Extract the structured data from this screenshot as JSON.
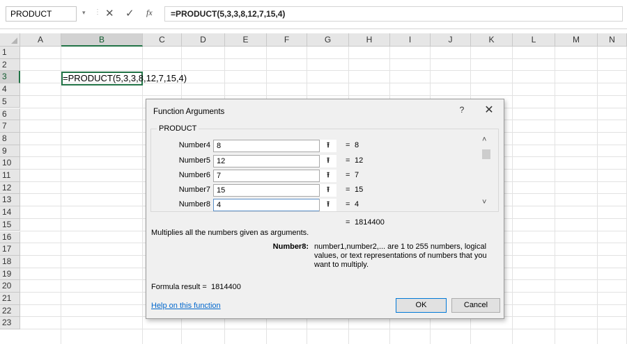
{
  "formula_bar": {
    "name_box": "PRODUCT",
    "name_box_arrow": "▾",
    "separator": "⋮",
    "cancel_glyph": "✕",
    "enter_glyph": "✓",
    "fx_label": "fx",
    "formula": "=PRODUCT(5,3,3,8,12,7,15,4)"
  },
  "grid": {
    "columns": [
      "A",
      "B",
      "C",
      "D",
      "E",
      "F",
      "G",
      "H",
      "I",
      "J",
      "K",
      "L",
      "M",
      "N"
    ],
    "rows": [
      "1",
      "2",
      "3",
      "4",
      "5",
      "6",
      "7",
      "8",
      "9",
      "10",
      "11",
      "12",
      "13",
      "14",
      "15",
      "16",
      "17",
      "18",
      "19",
      "20",
      "21",
      "22",
      "23"
    ],
    "active_column": "B",
    "active_row": "3",
    "cell_b3": "=PRODUCT(5,3,3,8,12,7,15,4)",
    "accent_color": "#217346"
  },
  "dialog": {
    "title": "Function Arguments",
    "help_glyph": "?",
    "close_glyph": "✕",
    "function_name": "PRODUCT",
    "args": [
      {
        "label": "Number4",
        "value": "8",
        "result": "8"
      },
      {
        "label": "Number5",
        "value": "12",
        "result": "12"
      },
      {
        "label": "Number6",
        "value": "7",
        "result": "7"
      },
      {
        "label": "Number7",
        "value": "15",
        "result": "15"
      },
      {
        "label": "Number8",
        "value": "4",
        "result": "4"
      }
    ],
    "ref_glyph": "⭱",
    "eq": "=",
    "scroll_up_glyph": "˄",
    "scroll_down_glyph": "˅",
    "total_result": "1814400",
    "description": "Multiplies all the numbers given as arguments.",
    "arg_name": "Number8:",
    "arg_description": "number1,number2,... are 1 to 255 numbers, logical values, or text representations of numbers that you want to multiply.",
    "formula_result_label": "Formula result =",
    "formula_result_value": "1814400",
    "help_link": "Help on this function",
    "ok_label": "OK",
    "cancel_label": "Cancel"
  }
}
